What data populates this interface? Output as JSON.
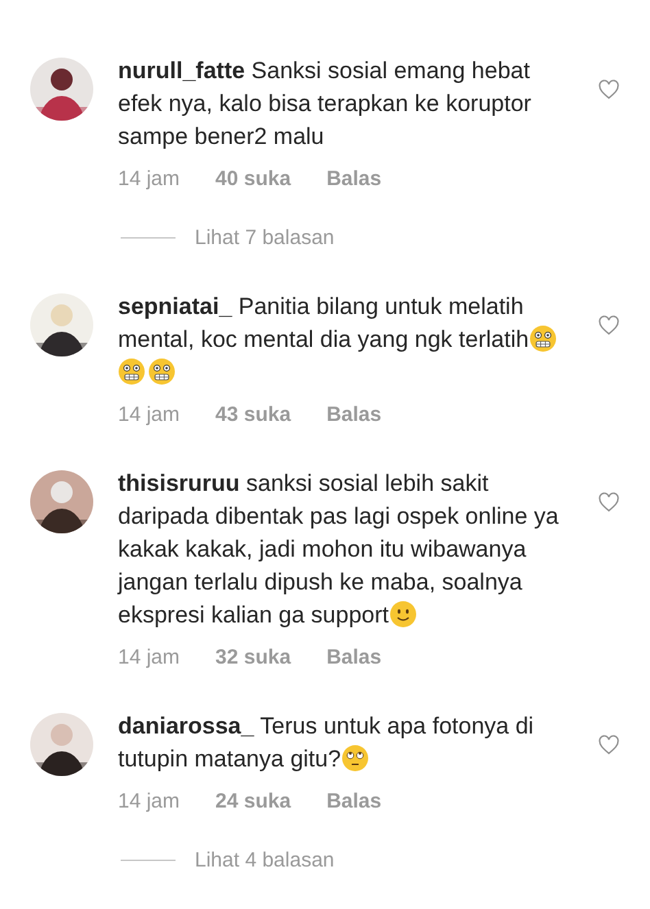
{
  "comments": [
    {
      "username": "nurull_fatte",
      "text": "Sanksi sosial emang hebat efek nya, kalo bisa terapkan ke koruptor sampe bener2 malu",
      "time": "14 jam",
      "likes": "40 suka",
      "reply": "Balas",
      "liked": false,
      "avatar": {
        "kind": "picture"
      },
      "view_replies": "Lihat 7 balasan"
    },
    {
      "username": "sepniatai_",
      "text": "Panitia bilang untuk melatih mental, koc mental dia yang ngk terlatih",
      "emojis": [
        {
          "kind": "grimace"
        },
        {
          "kind": "grimace"
        },
        {
          "kind": "grimace"
        }
      ],
      "time": "14 jam",
      "likes": "43 suka",
      "reply": "Balas",
      "liked": false,
      "avatar": {
        "kind": "picture"
      }
    },
    {
      "username": "thisisruruu",
      "text": "sanksi sosial lebih sakit daripada dibentak pas lagi ospek online ya kakak kakak, jadi mohon itu wibawanya jangan terlalu dipush ke maba, soalnya ekspresi kalian ga support",
      "emojis": [
        {
          "kind": "smile"
        }
      ],
      "time": "14 jam",
      "likes": "32 suka",
      "reply": "Balas",
      "liked": false,
      "avatar": {
        "kind": "picture"
      }
    },
    {
      "username": "daniarossa_",
      "text": "Terus untuk apa fotonya di tutupin matanya gitu?",
      "emojis": [
        {
          "kind": "eyeroll"
        }
      ],
      "time": "14 jam",
      "likes": "24 suka",
      "reply": "Balas",
      "liked": false,
      "avatar": {
        "kind": "picture"
      },
      "view_replies": "Lihat 4 balasan"
    }
  ]
}
